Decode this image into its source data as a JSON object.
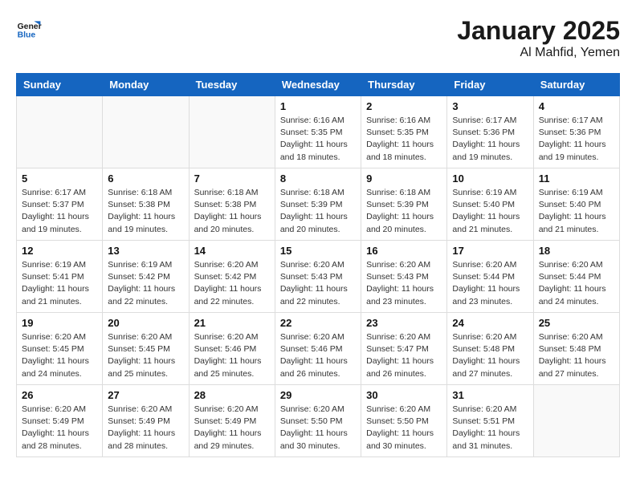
{
  "logo": {
    "text_general": "General",
    "text_blue": "Blue"
  },
  "title": "January 2025",
  "subtitle": "Al Mahfid, Yemen",
  "days_of_week": [
    "Sunday",
    "Monday",
    "Tuesday",
    "Wednesday",
    "Thursday",
    "Friday",
    "Saturday"
  ],
  "weeks": [
    [
      {
        "num": "",
        "info": ""
      },
      {
        "num": "",
        "info": ""
      },
      {
        "num": "",
        "info": ""
      },
      {
        "num": "1",
        "info": "Sunrise: 6:16 AM\nSunset: 5:35 PM\nDaylight: 11 hours and 18 minutes."
      },
      {
        "num": "2",
        "info": "Sunrise: 6:16 AM\nSunset: 5:35 PM\nDaylight: 11 hours and 18 minutes."
      },
      {
        "num": "3",
        "info": "Sunrise: 6:17 AM\nSunset: 5:36 PM\nDaylight: 11 hours and 19 minutes."
      },
      {
        "num": "4",
        "info": "Sunrise: 6:17 AM\nSunset: 5:36 PM\nDaylight: 11 hours and 19 minutes."
      }
    ],
    [
      {
        "num": "5",
        "info": "Sunrise: 6:17 AM\nSunset: 5:37 PM\nDaylight: 11 hours and 19 minutes."
      },
      {
        "num": "6",
        "info": "Sunrise: 6:18 AM\nSunset: 5:38 PM\nDaylight: 11 hours and 19 minutes."
      },
      {
        "num": "7",
        "info": "Sunrise: 6:18 AM\nSunset: 5:38 PM\nDaylight: 11 hours and 20 minutes."
      },
      {
        "num": "8",
        "info": "Sunrise: 6:18 AM\nSunset: 5:39 PM\nDaylight: 11 hours and 20 minutes."
      },
      {
        "num": "9",
        "info": "Sunrise: 6:18 AM\nSunset: 5:39 PM\nDaylight: 11 hours and 20 minutes."
      },
      {
        "num": "10",
        "info": "Sunrise: 6:19 AM\nSunset: 5:40 PM\nDaylight: 11 hours and 21 minutes."
      },
      {
        "num": "11",
        "info": "Sunrise: 6:19 AM\nSunset: 5:40 PM\nDaylight: 11 hours and 21 minutes."
      }
    ],
    [
      {
        "num": "12",
        "info": "Sunrise: 6:19 AM\nSunset: 5:41 PM\nDaylight: 11 hours and 21 minutes."
      },
      {
        "num": "13",
        "info": "Sunrise: 6:19 AM\nSunset: 5:42 PM\nDaylight: 11 hours and 22 minutes."
      },
      {
        "num": "14",
        "info": "Sunrise: 6:20 AM\nSunset: 5:42 PM\nDaylight: 11 hours and 22 minutes."
      },
      {
        "num": "15",
        "info": "Sunrise: 6:20 AM\nSunset: 5:43 PM\nDaylight: 11 hours and 22 minutes."
      },
      {
        "num": "16",
        "info": "Sunrise: 6:20 AM\nSunset: 5:43 PM\nDaylight: 11 hours and 23 minutes."
      },
      {
        "num": "17",
        "info": "Sunrise: 6:20 AM\nSunset: 5:44 PM\nDaylight: 11 hours and 23 minutes."
      },
      {
        "num": "18",
        "info": "Sunrise: 6:20 AM\nSunset: 5:44 PM\nDaylight: 11 hours and 24 minutes."
      }
    ],
    [
      {
        "num": "19",
        "info": "Sunrise: 6:20 AM\nSunset: 5:45 PM\nDaylight: 11 hours and 24 minutes."
      },
      {
        "num": "20",
        "info": "Sunrise: 6:20 AM\nSunset: 5:45 PM\nDaylight: 11 hours and 25 minutes."
      },
      {
        "num": "21",
        "info": "Sunrise: 6:20 AM\nSunset: 5:46 PM\nDaylight: 11 hours and 25 minutes."
      },
      {
        "num": "22",
        "info": "Sunrise: 6:20 AM\nSunset: 5:46 PM\nDaylight: 11 hours and 26 minutes."
      },
      {
        "num": "23",
        "info": "Sunrise: 6:20 AM\nSunset: 5:47 PM\nDaylight: 11 hours and 26 minutes."
      },
      {
        "num": "24",
        "info": "Sunrise: 6:20 AM\nSunset: 5:48 PM\nDaylight: 11 hours and 27 minutes."
      },
      {
        "num": "25",
        "info": "Sunrise: 6:20 AM\nSunset: 5:48 PM\nDaylight: 11 hours and 27 minutes."
      }
    ],
    [
      {
        "num": "26",
        "info": "Sunrise: 6:20 AM\nSunset: 5:49 PM\nDaylight: 11 hours and 28 minutes."
      },
      {
        "num": "27",
        "info": "Sunrise: 6:20 AM\nSunset: 5:49 PM\nDaylight: 11 hours and 28 minutes."
      },
      {
        "num": "28",
        "info": "Sunrise: 6:20 AM\nSunset: 5:49 PM\nDaylight: 11 hours and 29 minutes."
      },
      {
        "num": "29",
        "info": "Sunrise: 6:20 AM\nSunset: 5:50 PM\nDaylight: 11 hours and 30 minutes."
      },
      {
        "num": "30",
        "info": "Sunrise: 6:20 AM\nSunset: 5:50 PM\nDaylight: 11 hours and 30 minutes."
      },
      {
        "num": "31",
        "info": "Sunrise: 6:20 AM\nSunset: 5:51 PM\nDaylight: 11 hours and 31 minutes."
      },
      {
        "num": "",
        "info": ""
      }
    ]
  ]
}
